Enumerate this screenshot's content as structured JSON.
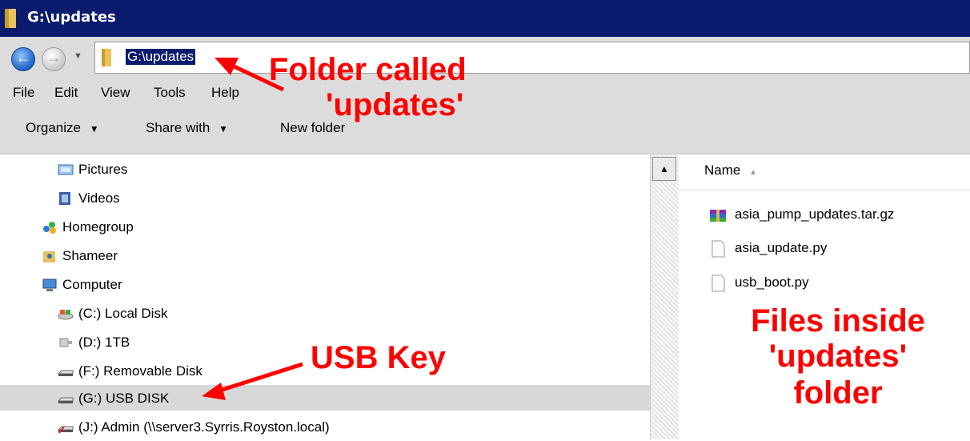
{
  "window": {
    "title": "G:\\updates"
  },
  "address": {
    "path": "G:\\updates"
  },
  "menu": [
    "File",
    "Edit",
    "View",
    "Tools",
    "Help"
  ],
  "toolbar": {
    "organize": "Organize",
    "share": "Share with",
    "new_folder": "New folder"
  },
  "nav": [
    {
      "label": "Pictures",
      "icon": "pictures-icon"
    },
    {
      "label": "Videos",
      "icon": "videos-icon"
    },
    {
      "label": "Homegroup",
      "icon": "homegroup-icon"
    },
    {
      "label": "Shameer",
      "icon": "user-folder-icon"
    },
    {
      "label": "Computer",
      "icon": "computer-icon"
    },
    {
      "label": "(C:) Local Disk",
      "icon": "local-disk-icon"
    },
    {
      "label": "(D:) 1TB",
      "icon": "drive-icon"
    },
    {
      "label": "(F:) Removable Disk",
      "icon": "removable-disk-icon"
    },
    {
      "label": "(G:) USB DISK",
      "icon": "usb-disk-icon",
      "selected": true
    },
    {
      "label": "(J:) Admin (\\\\server3.Syrris.Royston.local)",
      "icon": "network-drive-icon"
    }
  ],
  "files": {
    "column": "Name",
    "items": [
      {
        "name": "asia_pump_updates.tar.gz",
        "icon": "archive-icon"
      },
      {
        "name": "asia_update.py",
        "icon": "file-icon"
      },
      {
        "name": "usb_boot.py",
        "icon": "file-icon"
      }
    ]
  },
  "annotations": {
    "folder_line1": "Folder called",
    "folder_line2": "'updates'",
    "usb": "USB Key",
    "files_line1": "Files inside",
    "files_line2": "'updates'",
    "files_line3": "folder"
  },
  "colors": {
    "accent_red": "#ff0000",
    "titlebar": "#0a1b6e",
    "chrome": "#dcdcdc"
  }
}
